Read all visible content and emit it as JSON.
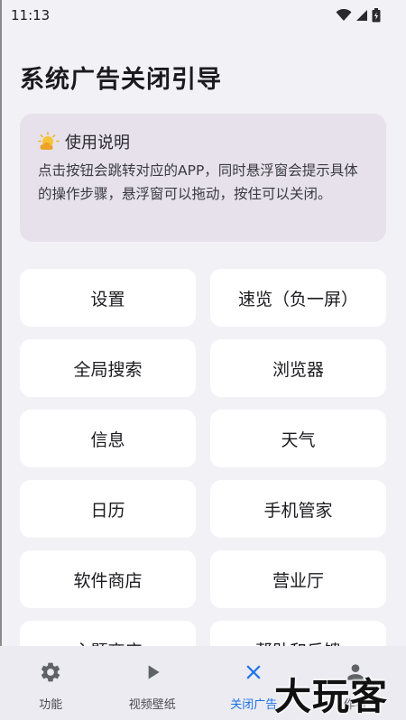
{
  "status_bar": {
    "time": "11:13"
  },
  "page": {
    "title": "系统广告关闭引导"
  },
  "info_card": {
    "icon": "sun-cloud-icon",
    "title": "使用说明",
    "body": "点击按钮会跳转对应的APP，同时悬浮窗会提示具体的操作步骤，悬浮窗可以拖动，按住可以关闭。"
  },
  "tiles": [
    {
      "label": "设置"
    },
    {
      "label": "速览（负一屏）"
    },
    {
      "label": "全局搜索"
    },
    {
      "label": "浏览器"
    },
    {
      "label": "信息"
    },
    {
      "label": "天气"
    },
    {
      "label": "日历"
    },
    {
      "label": "手机管家"
    },
    {
      "label": "软件商店"
    },
    {
      "label": "营业厅"
    },
    {
      "label": "主题商店"
    },
    {
      "label": "帮助和反馈"
    }
  ],
  "bottom_nav": {
    "items": [
      {
        "label": "功能",
        "icon": "gear-icon"
      },
      {
        "label": "视频壁纸",
        "icon": "play-icon"
      },
      {
        "label": "关闭广告",
        "icon": "close-icon",
        "active": true
      },
      {
        "label": "作者",
        "icon": "person-icon"
      }
    ],
    "active_color": "#1a73e8"
  },
  "watermark": {
    "text": "大玩客"
  }
}
